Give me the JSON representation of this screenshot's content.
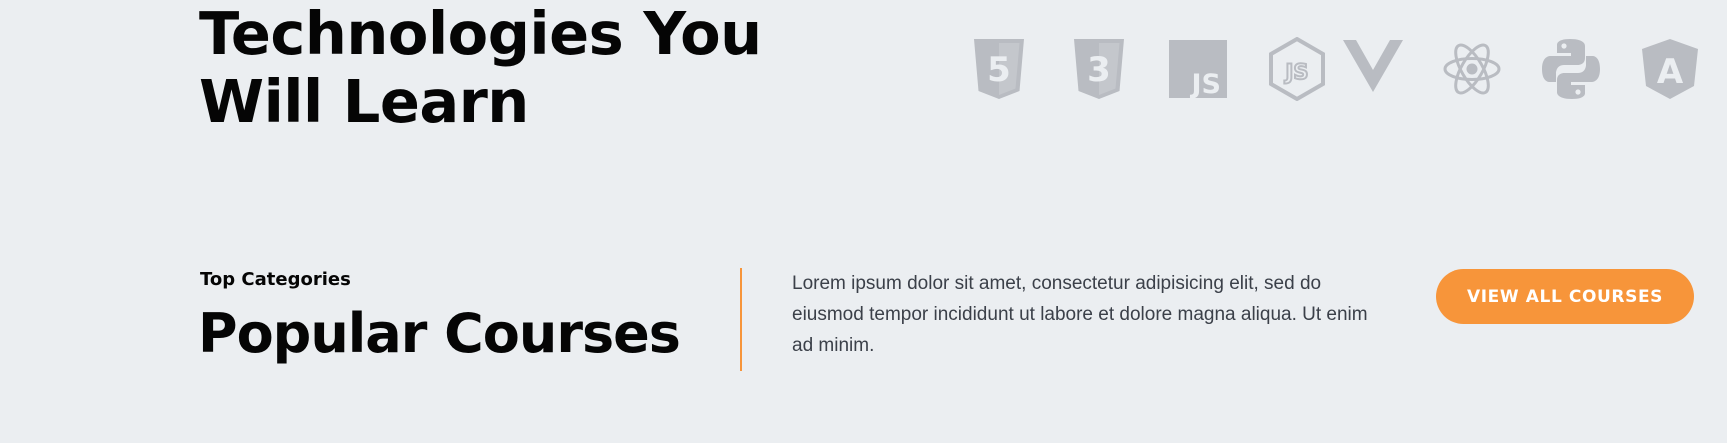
{
  "technologies": {
    "heading_line1": "Technologies You",
    "heading_line2": "Will Learn",
    "icons": [
      {
        "name": "html5-icon",
        "label": "5"
      },
      {
        "name": "css3-icon",
        "label": "3"
      },
      {
        "name": "javascript-icon",
        "label": "JS"
      },
      {
        "name": "nodejs-icon",
        "label": "JS"
      },
      {
        "name": "vuejs-icon",
        "label": ""
      },
      {
        "name": "react-icon",
        "label": ""
      },
      {
        "name": "python-icon",
        "label": ""
      },
      {
        "name": "angular-icon",
        "label": "A"
      }
    ],
    "icon_color": "#b9bcc2"
  },
  "categories": {
    "eyebrow": "Top Categories",
    "heading": "Popular Courses",
    "description": "Lorem ipsum dolor sit amet, consectetur adipisicing elit, sed do eiusmod tempor incididunt ut labore et dolore magna aliqua. Ut enim ad minim.",
    "view_all_label": "VIEW ALL COURSES"
  },
  "colors": {
    "background": "#ebeef1",
    "accent": "#f7953a",
    "heading": "#050505",
    "body_text": "#3b4049"
  }
}
